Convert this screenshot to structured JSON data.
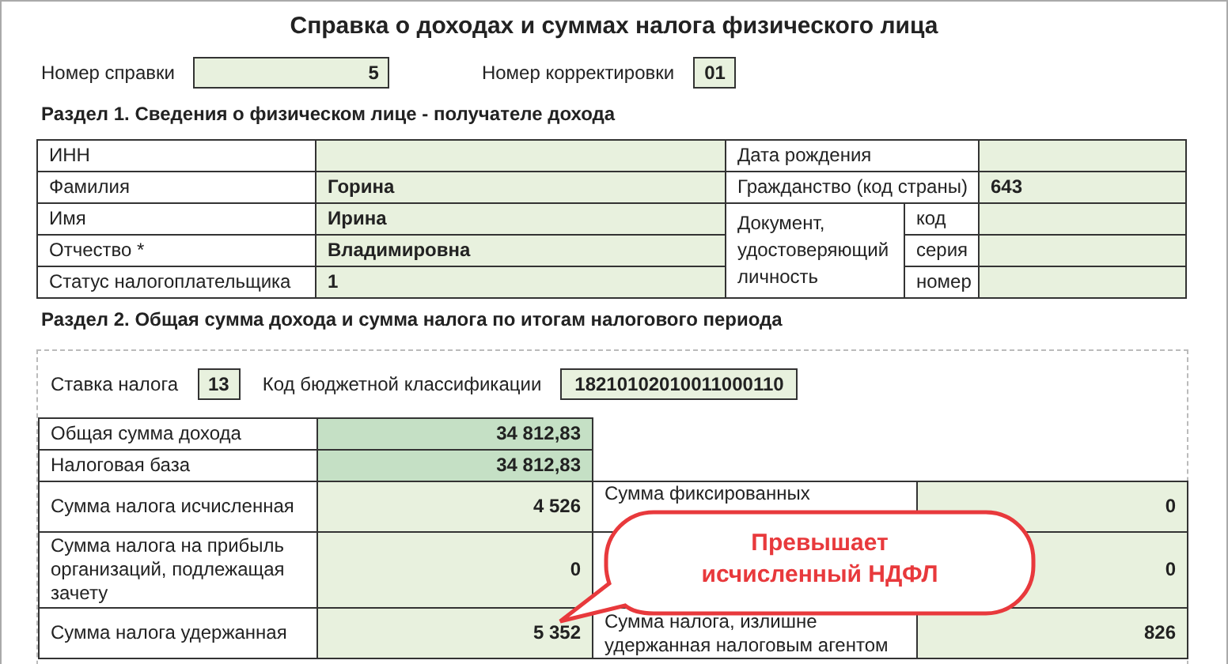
{
  "title": "Справка о доходах и суммах налога физического лица",
  "header_fields": [
    {
      "label": "Номер справки",
      "value": "5",
      "kind": "wide"
    },
    {
      "label": "Номер корректировки",
      "value": "01",
      "kind": "short"
    }
  ],
  "section1": {
    "heading": "Раздел 1. Сведения о физическом лице - получателе дохода",
    "left_rows": [
      {
        "label": "ИНН"
      },
      {
        "label": "Фамилия",
        "value": "Горина"
      },
      {
        "label": "Имя",
        "value": "Ирина"
      },
      {
        "label": "Отчество *",
        "value": "Владимировна"
      },
      {
        "label": "Статус налогоплательщика",
        "value": "1"
      }
    ],
    "right_rows": [
      {
        "label": "Дата рождения"
      },
      {
        "label": "Гражданство (код страны)",
        "value": "643"
      }
    ],
    "document": {
      "label": "Документ, удостоверяющий личность",
      "parts": [
        {
          "label": "код"
        },
        {
          "label": "серия"
        },
        {
          "label": "номер"
        }
      ]
    }
  },
  "section2": {
    "heading": "Раздел 2. Общая сумма дохода и сумма налога по итогам налогового периода",
    "rate": {
      "label": "Ставка налога",
      "value": "13"
    },
    "kbk": {
      "label": "Код бюджетной классификации",
      "value": "18210102010011000110"
    },
    "rows": [
      {
        "label": "Общая сумма дохода",
        "value": "34 812,83",
        "emphasis": true
      },
      {
        "label": "Налоговая база",
        "value": "34 812,83",
        "emphasis": true
      },
      {
        "label": "Сумма налога исчисленная",
        "value": "4 526",
        "emphasis": false,
        "right": {
          "label": "Сумма фиксированных",
          "value": "0"
        }
      },
      {
        "label": "Сумма налога на прибыль организаций, подлежащая зачету",
        "value": "0",
        "emphasis": false,
        "right": {
          "value": "0"
        }
      },
      {
        "label": "Сумма налога удержанная",
        "value": "5 352",
        "emphasis": false,
        "right": {
          "label": "Сумма налога, излишне удержанная налоговым агентом",
          "value": "826"
        }
      }
    ],
    "callout": "Превышает исчисленный НДФЛ"
  }
}
